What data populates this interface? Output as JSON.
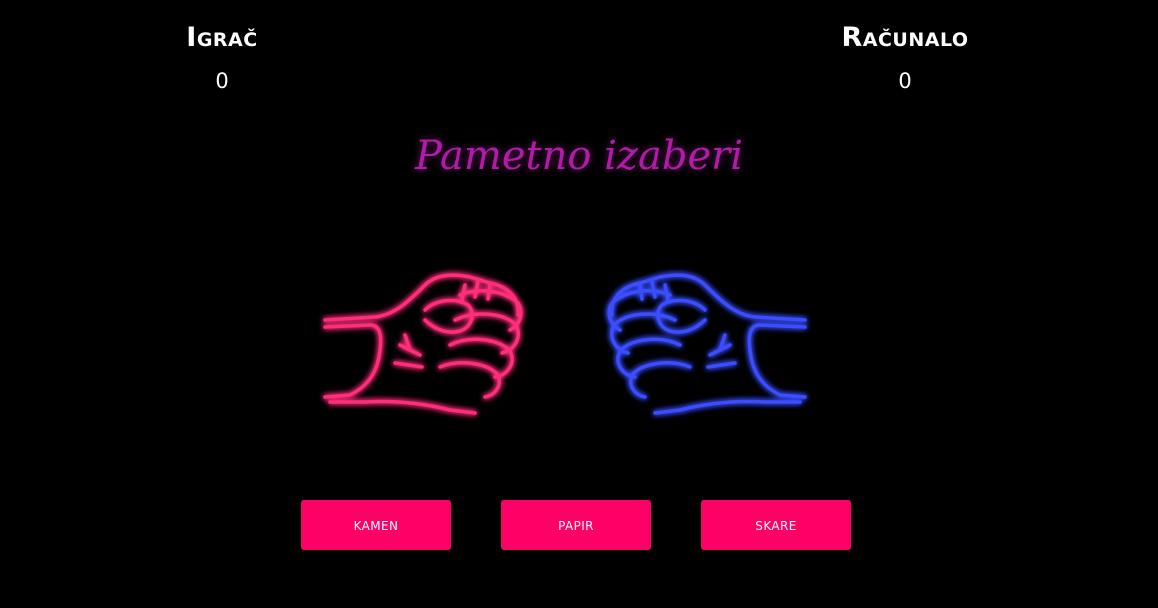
{
  "scoreboard": {
    "player": {
      "name": "Igrač",
      "score": "0"
    },
    "computer": {
      "name": "Računalo",
      "score": "0"
    }
  },
  "title": "Pametno izaberi",
  "hands": {
    "player": {
      "icon": "fist-icon",
      "color": "#ff2d7a",
      "glow": "#ff0066"
    },
    "computer": {
      "icon": "fist-icon",
      "color": "#3a4dff",
      "glow": "#1f2bff"
    }
  },
  "choices": [
    {
      "label": "kamen"
    },
    {
      "label": "papir"
    },
    {
      "label": "skare"
    }
  ],
  "colors": {
    "background": "#000000",
    "button": "#ff0066",
    "title": "#b21aa8"
  }
}
